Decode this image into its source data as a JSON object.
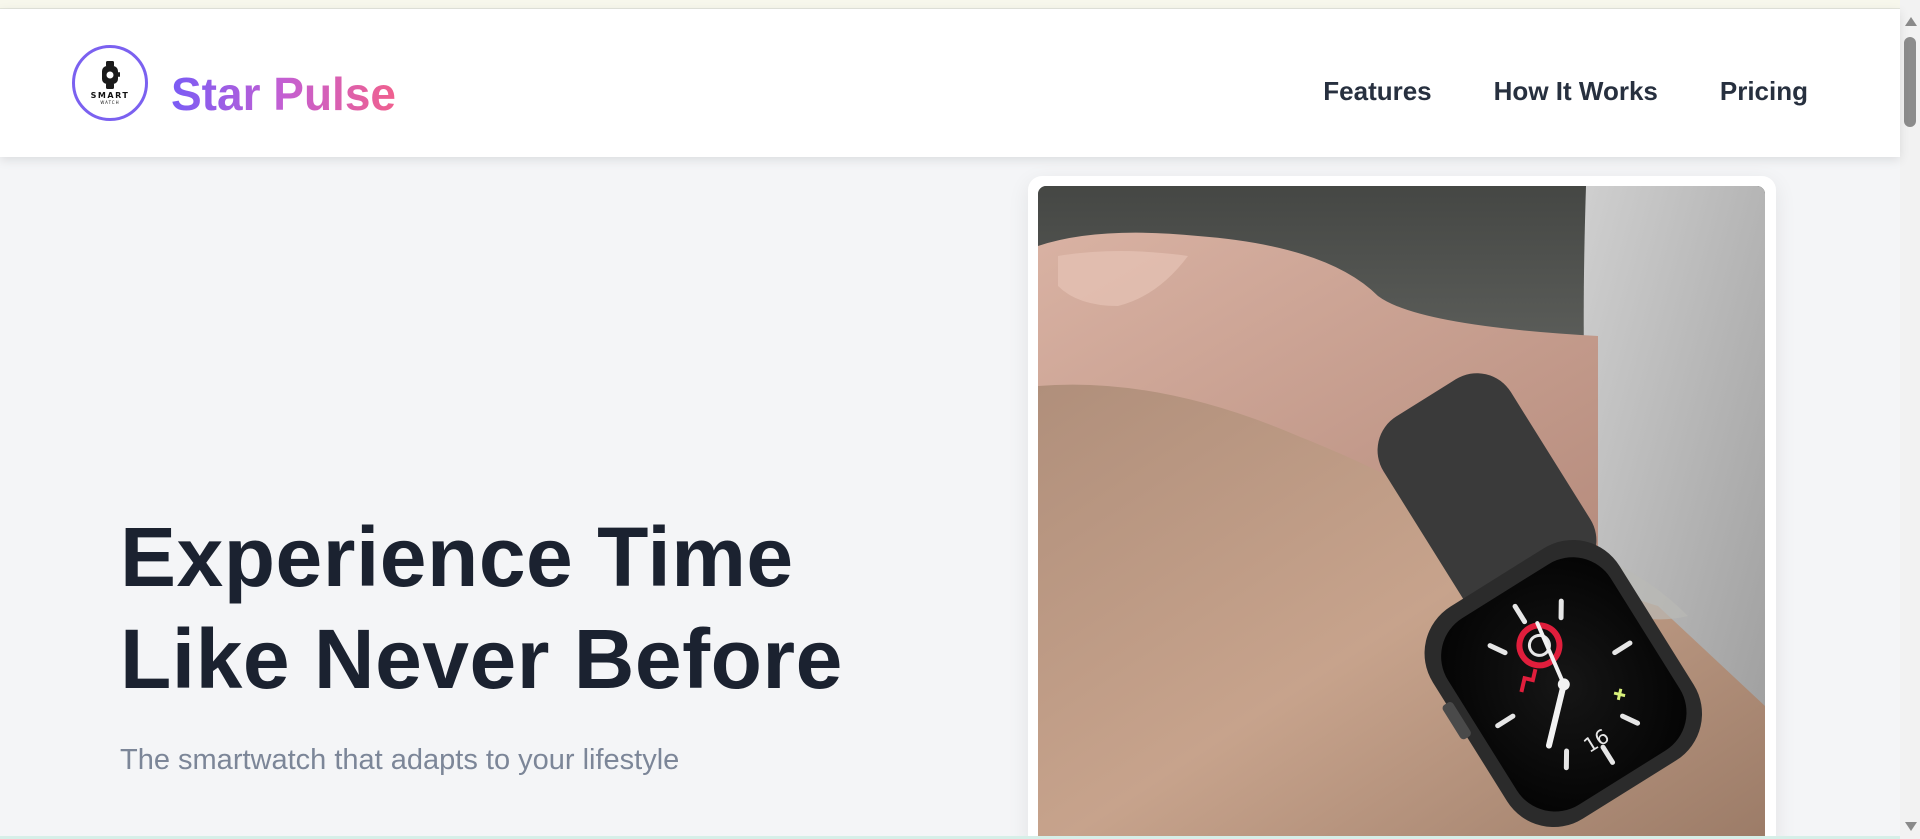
{
  "brand": {
    "name": "Star Pulse",
    "logo_text_primary": "SMART",
    "logo_text_secondary": "WATCH",
    "gradient_start": "#7a5cf5",
    "gradient_end": "#f0608e"
  },
  "nav": {
    "items": [
      {
        "label": "Features"
      },
      {
        "label": "How It Works"
      },
      {
        "label": "Pricing"
      }
    ]
  },
  "hero": {
    "title_line1": "Experience Time",
    "title_line2": "Like Never Before",
    "subtitle": "The smartwatch that adapts to your lifestyle",
    "watch_face_number": "16"
  },
  "colors": {
    "page_background": "#f4f5f7",
    "heading": "#1b2230",
    "subtitle": "#7c8698",
    "logo_ring": "#7b61f0"
  }
}
